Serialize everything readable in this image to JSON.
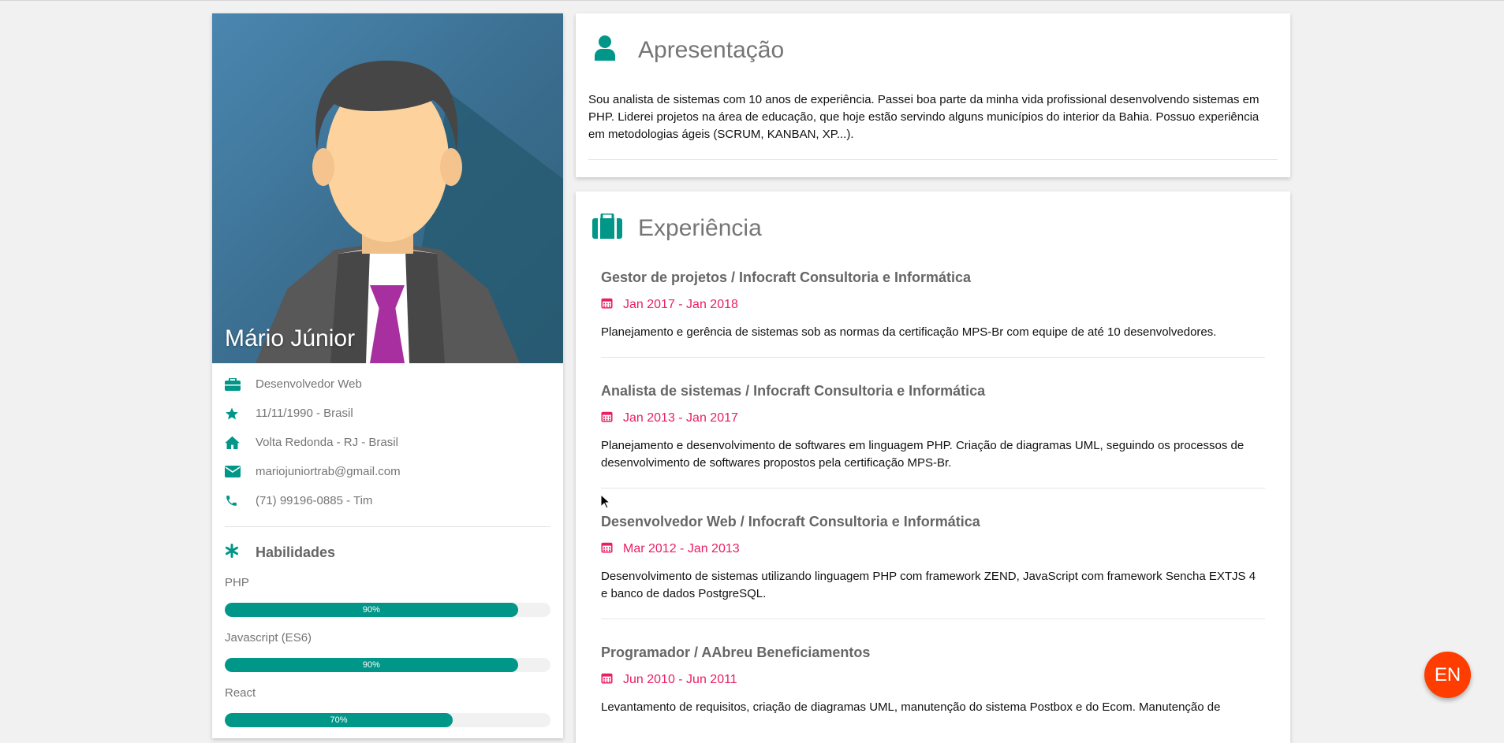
{
  "profile": {
    "name": "Mário Júnior",
    "info": [
      {
        "icon": "briefcase-icon",
        "text": "Desenvolvedor Web"
      },
      {
        "icon": "star-icon",
        "text": "11/11/1990 - Brasil"
      },
      {
        "icon": "home-icon",
        "text": "Volta Redonda - RJ - Brasil"
      },
      {
        "icon": "envelope-icon",
        "text": "mariojuniortrab@gmail.com"
      },
      {
        "icon": "phone-icon",
        "text": "(71) 99196-0885 - Tim"
      }
    ],
    "skills_title": "Habilidades",
    "skills": [
      {
        "name": "PHP",
        "level": 90,
        "label": "90%"
      },
      {
        "name": "Javascript (ES6)",
        "level": 90,
        "label": "90%"
      },
      {
        "name": "React",
        "level": 70,
        "label": "70%"
      }
    ]
  },
  "about": {
    "title": "Apresentação",
    "text": "Sou analista de sistemas com 10 anos de experiência. Passei boa parte da minha vida profissional desenvolvendo sistemas em PHP. Liderei projetos na área de educação, que hoje estão servindo alguns municípios do interior da Bahia. Possuo experiência em metodologias ágeis (SCRUM, KANBAN, XP...)."
  },
  "experience": {
    "title": "Experiência",
    "jobs": [
      {
        "title": "Gestor de projetos / Infocraft Consultoria e Informática",
        "date": "Jan 2017 - Jan 2018",
        "desc": "Planejamento e gerência de sistemas sob as normas da certificação MPS-Br com equipe de até 10 desenvolvedores."
      },
      {
        "title": "Analista de sistemas / Infocraft Consultoria e Informática",
        "date": "Jan 2013 - Jan 2017",
        "desc": "Planejamento e desenvolvimento de softwares em linguagem PHP. Criação de diagramas UML, seguindo os processos de desenvolvimento de softwares propostos pela certificação MPS-Br."
      },
      {
        "title": "Desenvolvedor Web / Infocraft Consultoria e Informática",
        "date": "Mar 2012 - Jan 2013",
        "desc": "Desenvolvimento de sistemas utilizando linguagem PHP com framework ZEND, JavaScript com framework Sencha EXTJS 4 e banco de dados PostgreSQL."
      },
      {
        "title": "Programador / AAbreu Beneficiamentos",
        "date": "Jun 2010 - Jun 2011",
        "desc": "Levantamento de requisitos, criação de diagramas UML, manutenção do sistema Postbox e do Ecom. Manutenção de"
      }
    ]
  },
  "language_button": "EN",
  "colors": {
    "accent": "#009688",
    "date": "#e91e63",
    "lang_button": "#ff3d00"
  }
}
